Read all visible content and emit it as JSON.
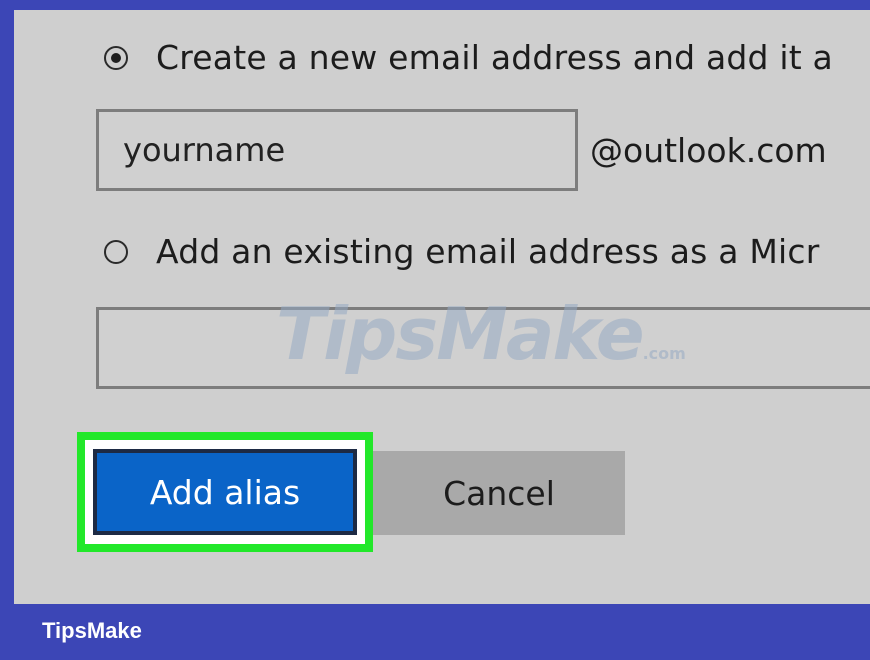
{
  "options": {
    "create_new": {
      "label": "Create a new email address and add it a",
      "selected": true,
      "username_value": "yourname",
      "domain": "@outlook.com"
    },
    "add_existing": {
      "label": "Add an existing email address as a Micr",
      "selected": false,
      "email_value": ""
    }
  },
  "buttons": {
    "add_alias_label": "Add alias",
    "cancel_label": "Cancel"
  },
  "watermark": {
    "text": "TipsMake",
    "suffix": ".com"
  },
  "footer": {
    "brand": "TipsMake"
  },
  "colors": {
    "frame_border": "#3c46b6",
    "panel_background": "#cfcfcf",
    "primary_button": "#0a64c8",
    "secondary_button": "#a9a9a9",
    "highlight": "#22e82a"
  }
}
